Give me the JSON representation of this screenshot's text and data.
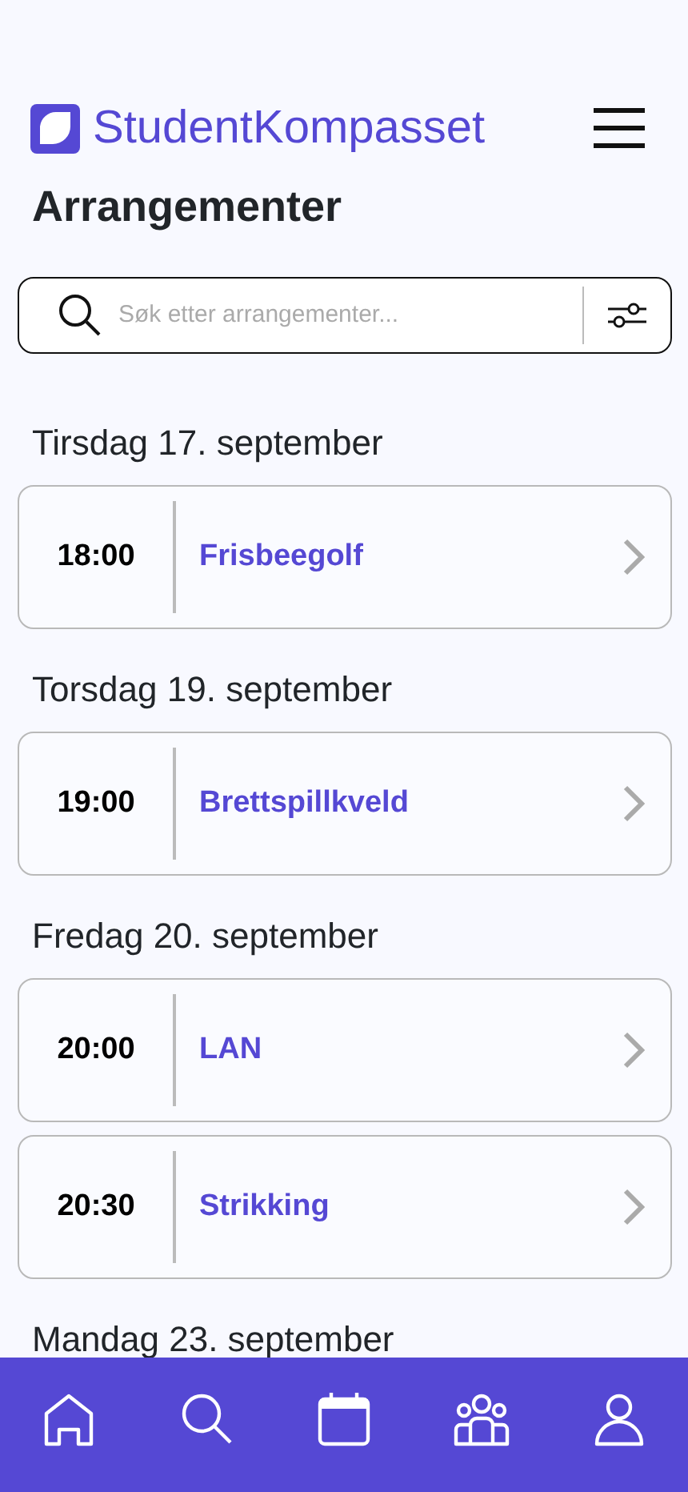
{
  "brand": {
    "name": "StudentKompasset"
  },
  "title": "Arrangementer",
  "search": {
    "placeholder": "Søk etter arrangementer..."
  },
  "days": [
    {
      "label": "Tirsdag 17. september",
      "events": [
        {
          "time": "18:00",
          "name": "Frisbeegolf"
        }
      ]
    },
    {
      "label": "Torsdag 19. september",
      "events": [
        {
          "time": "19:00",
          "name": "Brettspillkveld"
        }
      ]
    },
    {
      "label": "Fredag 20. september",
      "events": [
        {
          "time": "20:00",
          "name": "LAN"
        },
        {
          "time": "20:30",
          "name": "Strikking"
        }
      ]
    },
    {
      "label": "Mandag 23. september"
    }
  ],
  "bottom_nav": [
    {
      "kind": "home"
    },
    {
      "kind": "search"
    },
    {
      "kind": "calendar"
    },
    {
      "kind": "groups"
    },
    {
      "kind": "profile"
    }
  ]
}
